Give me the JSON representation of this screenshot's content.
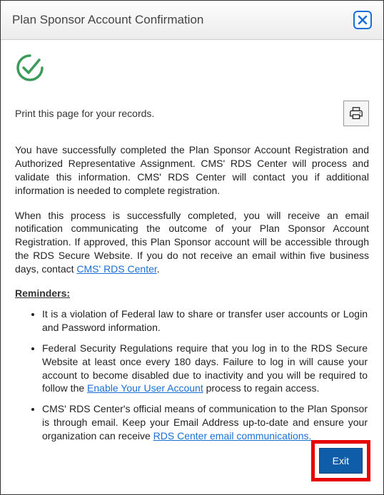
{
  "header": {
    "title": "Plan Sponsor Account Confirmation"
  },
  "print_instruction": "Print this page for your records.",
  "paragraph1": "You have successfully completed the Plan Sponsor Account Registration and Authorized Representative Assignment. CMS' RDS Center will process and validate this information. CMS' RDS Center will contact you if additional information is needed to complete registration.",
  "paragraph2_a": "When this process is successfully completed, you will receive an email notification communicating the outcome of your Plan Sponsor Account Registration. If approved, this Plan Sponsor account will be accessible through the RDS Secure Website. If you do not receive an email within five business days, contact ",
  "paragraph2_link": "CMS' RDS Center",
  "paragraph2_b": ".",
  "reminders_heading": "Reminders:",
  "reminders": {
    "item1": "It is a violation of Federal law to share or transfer user accounts or Login and Password information.",
    "item2_a": "Federal Security Regulations require that you log in to the RDS Secure Website at least once every 180 days. Failure to log in will cause your account to become disabled due to inactivity and you will be required to follow the ",
    "item2_link": "Enable Your User Account",
    "item2_b": " process to regain access.",
    "item3_a": "CMS' RDS Center's official means of communication to the Plan Sponsor is through email. Keep your Email Address up-to-date and ensure your organization can receive ",
    "item3_link": "RDS Center email communications.",
    "item3_b": ""
  },
  "buttons": {
    "exit": "Exit"
  }
}
